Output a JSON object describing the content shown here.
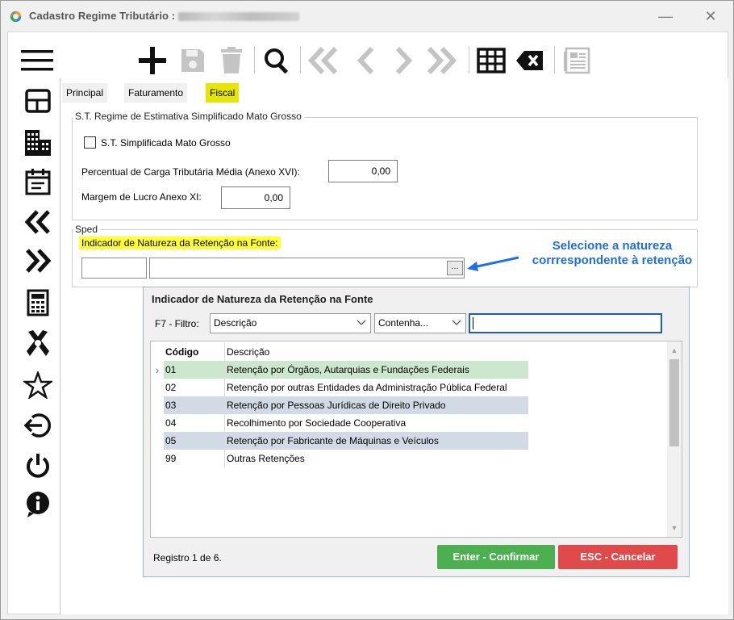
{
  "window": {
    "title": "Cadastro Regime Tributário :",
    "minimize": "—",
    "close": "✕"
  },
  "toolbar": {
    "icons": [
      "menu-icon",
      "plus-icon",
      "save-icon",
      "trash-icon",
      "search-icon",
      "first-icon",
      "prev-icon",
      "next-icon",
      "last-icon",
      "grid-icon",
      "clear-icon",
      "report-icon"
    ]
  },
  "sidebar": {
    "icons": [
      "layout-icon",
      "buildings-icon",
      "calendar-icon",
      "double-left-icon",
      "double-right-icon",
      "calculator-icon",
      "tools-icon",
      "star-icon",
      "exit-icon",
      "power-icon",
      "info-icon"
    ]
  },
  "tabs": [
    {
      "label": "Principal"
    },
    {
      "label": "Faturamento"
    },
    {
      "label": "Fiscal"
    }
  ],
  "st_group": {
    "legend": "S.T. Regime de Estimativa Simplificado Mato Grosso",
    "checkbox_label": "S.T. Simplificada Mato Grosso",
    "carga_label": "Percentual de Carga Tributária Média (Anexo XVI):",
    "carga_value": "0,00",
    "margem_label": "Margem de Lucro Anexo XI:",
    "margem_value": "0,00"
  },
  "sped_group": {
    "legend": "Sped",
    "indicador_label": "Indicador de Natureza da Retenção na Fonte:",
    "lookup_button": "..."
  },
  "callout": {
    "line1": "Selecione a natureza",
    "line2": "corrrespondente à retenção",
    "color": "#1f6fe0"
  },
  "popup": {
    "title": "Indicador de Natureza da Retenção na Fonte",
    "filter_label": "F7 - Filtro:",
    "filter_field": "Descrição",
    "filter_operator": "Contenha...",
    "filter_value": "",
    "columns": {
      "codigo": "Código",
      "descricao": "Descrição"
    },
    "rows": [
      {
        "codigo": "01",
        "descricao": "Retenção por Órgãos, Autarquias e Fundações Federais"
      },
      {
        "codigo": "02",
        "descricao": "Retenção por outras Entidades da Administração Pública Federal"
      },
      {
        "codigo": "03",
        "descricao": "Retenção por Pessoas Jurídicas de Direito Privado"
      },
      {
        "codigo": "04",
        "descricao": "Recolhimento por Sociedade Cooperativa"
      },
      {
        "codigo": "05",
        "descricao": "Retenção por Fabricante de Máquinas e Veículos"
      },
      {
        "codigo": "99",
        "descricao": "Outras Retenções"
      }
    ],
    "status": "Registro 1 de 6.",
    "confirm_label": "Enter - Confirmar",
    "cancel_label": "ESC - Cancelar",
    "confirm_color": "#4caf50",
    "cancel_color": "#e04a4a",
    "selected_row_color": "#cde7cf",
    "alt_row_color": "#d2dbe5"
  }
}
